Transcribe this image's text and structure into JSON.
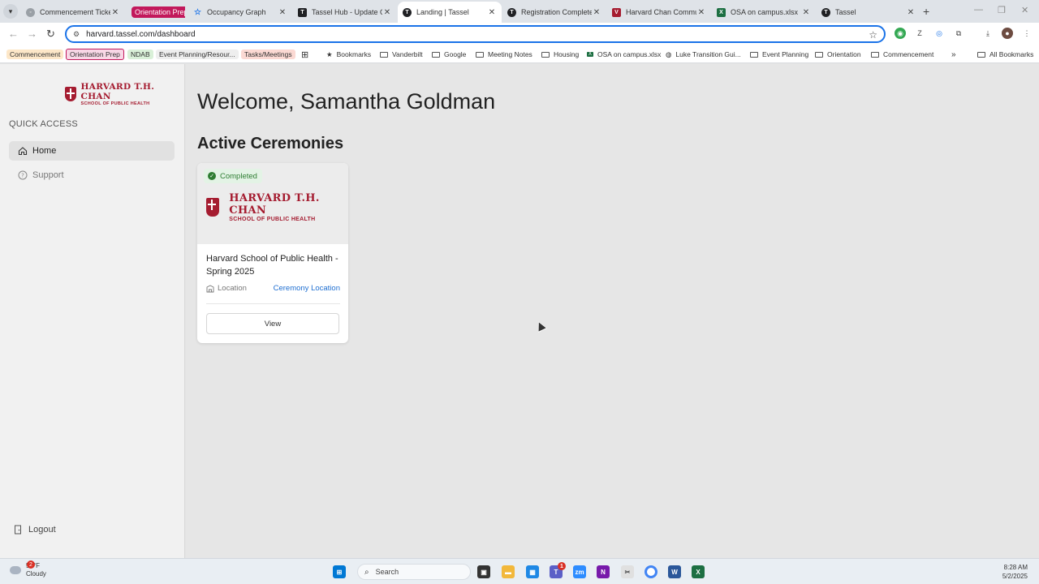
{
  "browser": {
    "tabs": [
      {
        "label": "Commencement Ticket",
        "favicon": "globe-icon",
        "color": "#5f6368"
      },
      {
        "label": "Orientation Prep",
        "type": "group",
        "color": "#c2185b"
      },
      {
        "label": "Occupancy Graph",
        "favicon": "star-icon",
        "color": "#1a73e8"
      },
      {
        "label": "Tassel Hub - Update Gr",
        "favicon": "doc-icon",
        "color": "#202124"
      },
      {
        "label": "Landing | Tassel",
        "favicon": "tassel-icon",
        "color": "#202124",
        "active": true
      },
      {
        "label": "Registration Complete",
        "favicon": "tassel-icon",
        "color": "#202124"
      },
      {
        "label": "Harvard Chan Commu",
        "favicon": "harvard-icon",
        "color": "#a51c30"
      },
      {
        "label": "OSA on campus.xlsx",
        "favicon": "excel-icon",
        "color": "#1d6f42"
      },
      {
        "label": "Tassel",
        "favicon": "tassel-icon",
        "color": "#202124"
      }
    ],
    "new_tab": "+",
    "url": "harvard.tassel.com/dashboard",
    "bookmarks": [
      {
        "label": "Commencement",
        "type": "chip",
        "bg": "#fde7c8"
      },
      {
        "label": "Orientation Prep",
        "type": "chip-outline",
        "bg": "#f8d7e6"
      },
      {
        "label": "NDAB",
        "type": "chip",
        "bg": "#d9f0d8"
      },
      {
        "label": "Event Planning/Resour...",
        "type": "chip",
        "bg": "#eeeeee"
      },
      {
        "label": "Tasks/Meetings",
        "type": "chip",
        "bg": "#fbd9d3"
      },
      {
        "label": "Bookmarks",
        "type": "star"
      },
      {
        "label": "Vanderbilt",
        "type": "folder"
      },
      {
        "label": "Google",
        "type": "folder"
      },
      {
        "label": "Meeting Notes",
        "type": "folder"
      },
      {
        "label": "Housing",
        "type": "folder"
      },
      {
        "label": "OSA on campus.xlsx",
        "type": "excel"
      },
      {
        "label": "Luke Transition Gui...",
        "type": "globe"
      },
      {
        "label": "Event Planning",
        "type": "folder"
      },
      {
        "label": "Orientation",
        "type": "folder"
      },
      {
        "label": "Commencement",
        "type": "folder"
      }
    ],
    "all_bookmarks": "All Bookmarks"
  },
  "sidebar": {
    "logo_main": "HARVARD T.H. CHAN",
    "logo_sub": "SCHOOL OF PUBLIC HEALTH",
    "section_label": "QUICK ACCESS",
    "items": [
      {
        "label": "Home",
        "icon": "home-icon",
        "active": true
      },
      {
        "label": "Support",
        "icon": "help-circle-icon",
        "active": false
      }
    ],
    "logout_label": "Logout"
  },
  "main": {
    "welcome": "Welcome, Samantha Goldman",
    "section_title": "Active Ceremonies",
    "card": {
      "status": "Completed",
      "status_color": "#2e7d32",
      "logo_main": "HARVARD T.H. CHAN",
      "logo_sub": "SCHOOL OF PUBLIC HEALTH",
      "title": "Harvard School of Public Health - Spring 2025",
      "location_label": "Location",
      "location_link": "Ceremony Location",
      "button": "View"
    }
  },
  "taskbar": {
    "weather_temp": "56°F",
    "weather_desc": "Cloudy",
    "weather_alert": "2",
    "search_placeholder": "Search",
    "teams_badge": "1",
    "time": "8:28 AM",
    "date": "5/2/2025"
  }
}
